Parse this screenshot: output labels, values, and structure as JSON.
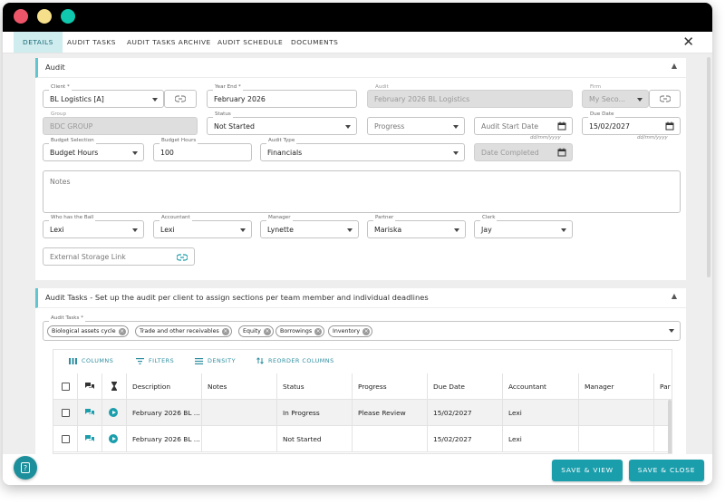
{
  "tabs": [
    {
      "label": "Details",
      "active": true
    },
    {
      "label": "Audit Tasks"
    },
    {
      "label": "Audit Tasks Archive"
    },
    {
      "label": "Audit Schedule"
    },
    {
      "label": "Documents"
    }
  ],
  "close_glyph": "✕",
  "audit": {
    "title": "Audit",
    "client": {
      "label": "Client *",
      "value": "BL Logistics [A]"
    },
    "year_end": {
      "label": "Year End *",
      "value": "February 2026"
    },
    "audit_name": {
      "label": "Audit",
      "value": "February 2026 BL Logistics"
    },
    "firm": {
      "label": "Firm",
      "value": "My Seco..."
    },
    "group": {
      "label": "Group",
      "value": "BDC GROUP"
    },
    "status": {
      "label": "Status",
      "value": "Not Started"
    },
    "progress": {
      "placeholder": "Progress"
    },
    "audit_start_date": {
      "placeholder": "Audit Start Date",
      "hint": "dd/mm/yyyy"
    },
    "due_date": {
      "label": "Due Date",
      "value": "15/02/2027",
      "hint": "dd/mm/yyyy"
    },
    "budget_selection": {
      "label": "Budget Selection",
      "value": "Budget Hours"
    },
    "budget_hours": {
      "label": "Budget Hours",
      "value": "100"
    },
    "audit_type": {
      "label": "Audit Type",
      "value": "Financials"
    },
    "date_completed": {
      "placeholder": "Date Completed"
    },
    "notes": {
      "placeholder": "Notes"
    },
    "who_has_ball": {
      "label": "Who has the Ball",
      "value": "Lexi"
    },
    "accountant": {
      "label": "Accountant",
      "value": "Lexi"
    },
    "manager": {
      "label": "Manager",
      "value": "Lynette"
    },
    "partner": {
      "label": "Partner",
      "value": "Mariska"
    },
    "clerk": {
      "label": "Clerk",
      "value": "Jay"
    },
    "external_storage": {
      "placeholder": "External Storage Link"
    }
  },
  "audit_tasks": {
    "title": "Audit Tasks - Set up the audit per client to assign sections per team member and individual deadlines",
    "field_label": "Audit Tasks *",
    "chips": [
      "Biological assets cycle",
      "Trade and other receivables",
      "Equity",
      "Borrowings",
      "Inventory"
    ],
    "toolbar": {
      "columns": "Columns",
      "filters": "Filters",
      "density": "Density",
      "reorder": "Reorder Columns"
    },
    "columns": [
      "Description",
      "Notes",
      "Status",
      "Progress",
      "Due Date",
      "Accountant",
      "Manager",
      "Par"
    ],
    "rows": [
      {
        "description": "February 2026 BL ...",
        "notes": "",
        "status": "In Progress",
        "progress": "Please Review",
        "due_date": "15/02/2027",
        "accountant": "Lexi",
        "manager": "",
        "partner": ""
      },
      {
        "description": "February 2026 BL ...",
        "notes": "",
        "status": "Not Started",
        "progress": "",
        "due_date": "15/02/2027",
        "accountant": "Lexi",
        "manager": "",
        "partner": ""
      }
    ]
  },
  "footer": {
    "save_view": "Save & View",
    "save_close": "Save & Close"
  },
  "colors": {
    "accent": "#1b9eac",
    "panel_border": "#5fc6cf",
    "active_tab": "#cfecee"
  }
}
